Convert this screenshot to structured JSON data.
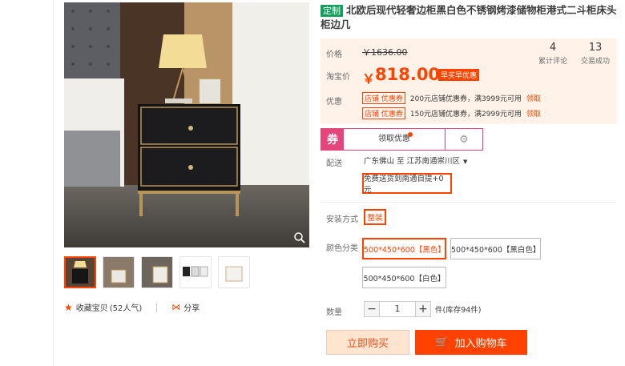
{
  "product": {
    "tag": "定制",
    "title": "北欧后现代轻奢边柜黑白色不锈钢烤漆储物柜港式二斗柜床头柜边几"
  },
  "gallery": {
    "thumb_count": 5,
    "favorite_label": "收藏宝贝",
    "favorite_count": "(52人气)",
    "share_label": "分享"
  },
  "price": {
    "label_price": "价格",
    "original": "￥1636.00",
    "label_tb": "淘宝价",
    "currency": "￥",
    "current": "818.00",
    "early_badge": "早买早优惠"
  },
  "stats": {
    "reviews_count": "4",
    "reviews_label": "累计评论",
    "sales_count": "13",
    "sales_label": "交易成功"
  },
  "promo": {
    "label": "优惠",
    "coupons": [
      {
        "tag": "店铺 优惠券",
        "text": "200元店铺优惠券，满3999元可用",
        "action": "领取"
      },
      {
        "tag": "店铺 优惠券",
        "text": "150元店铺优惠券，满2999元可用",
        "action": "领取"
      }
    ]
  },
  "quan": {
    "icon": "券",
    "text": "领取优惠"
  },
  "delivery": {
    "label": "配送",
    "route": "广东佛山 至  江苏南通崇川区",
    "option": "免费送货到南通自提+0元"
  },
  "install": {
    "label": "安装方式",
    "option": "整装"
  },
  "color": {
    "label": "颜色分类",
    "options": [
      "500*450*600【黑色】",
      "500*450*600【黑白色】",
      "500*450*600【白色】"
    ]
  },
  "quantity": {
    "label": "数量",
    "value": "1",
    "minus": "−",
    "plus": "+",
    "stock": "件(库存94件)"
  },
  "actions": {
    "buy_now": "立即购买",
    "add_cart": "加入购物车"
  },
  "colors": {
    "accent": "#ff4400",
    "coupon_pink": "#e4467c",
    "tag_green": "#12a05c",
    "price_bg": "#fff2e8"
  }
}
